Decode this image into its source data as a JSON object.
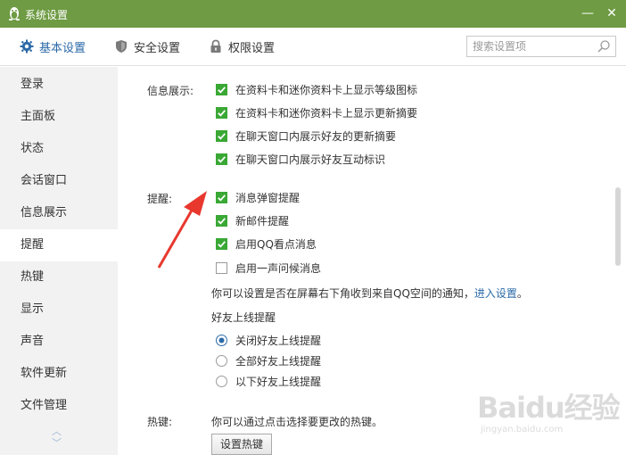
{
  "window": {
    "title": "系统设置",
    "minimize_glyph": "—",
    "close_glyph": "✕"
  },
  "tabs": [
    {
      "label": "基本设置",
      "icon": "gear-icon",
      "active": true
    },
    {
      "label": "安全设置",
      "icon": "shield-icon",
      "active": false
    },
    {
      "label": "权限设置",
      "icon": "lock-icon",
      "active": false
    }
  ],
  "search": {
    "placeholder": "搜索设置项",
    "icon": "search-icon"
  },
  "sidebar": {
    "items": [
      {
        "label": "登录"
      },
      {
        "label": "主面板"
      },
      {
        "label": "状态"
      },
      {
        "label": "会话窗口"
      },
      {
        "label": "信息展示"
      },
      {
        "label": "提醒",
        "active": true
      },
      {
        "label": "热键"
      },
      {
        "label": "显示"
      },
      {
        "label": "声音"
      },
      {
        "label": "软件更新"
      },
      {
        "label": "文件管理"
      }
    ],
    "scroll_up": "︿",
    "scroll_down": "﹀"
  },
  "info_display": {
    "label": "信息展示:",
    "options": [
      {
        "label": "在资料卡和迷你资料卡上显示等级图标",
        "checked": true
      },
      {
        "label": "在资料卡和迷你资料卡上显示更新摘要",
        "checked": true
      },
      {
        "label": "在聊天窗口内展示好友的更新摘要",
        "checked": true
      },
      {
        "label": "在聊天窗口内展示好友互动标识",
        "checked": true
      }
    ]
  },
  "reminder": {
    "label": "提醒:",
    "options": [
      {
        "label": "消息弹窗提醒",
        "checked": true
      },
      {
        "label": "新邮件提醒",
        "checked": true
      },
      {
        "label": "启用QQ看点消息",
        "checked": true
      },
      {
        "label": "启用一声问候消息",
        "checked": false
      }
    ],
    "note_text": "你可以设置是否在屏幕右下角收到来自QQ空间的通知，",
    "note_link": "进入设置",
    "note_end": "。",
    "friend_online_title": "好友上线提醒",
    "friend_online_options": [
      {
        "label": "关闭好友上线提醒",
        "selected": true
      },
      {
        "label": "全部好友上线提醒",
        "selected": false
      },
      {
        "label": "以下好友上线提醒",
        "selected": false
      }
    ]
  },
  "hotkey": {
    "label": "热键:",
    "note": "你可以通过点击选择要更改的热键。",
    "button": "设置热键"
  },
  "colors": {
    "titlebar": "#6e9b43",
    "accent": "#2b6aa8",
    "checkbox": "#3aa835",
    "annotation_arrow": "#e8382e"
  },
  "watermark": {
    "text": "Baidu经验",
    "sub": "jingyan.baidu.com"
  }
}
